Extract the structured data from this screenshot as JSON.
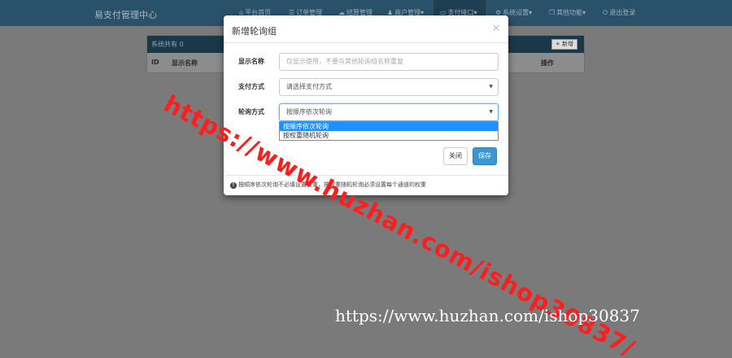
{
  "navbar": {
    "brand": "易支付管理中心",
    "items": [
      {
        "icon": "home-icon",
        "glyph": "⌂",
        "label": "平台首页"
      },
      {
        "icon": "list-icon",
        "glyph": "☰",
        "label": "订单管理"
      },
      {
        "icon": "cloud-icon",
        "glyph": "☁",
        "label": "结算管理"
      },
      {
        "icon": "user-icon",
        "glyph": "♟",
        "label": "商户管理"
      },
      {
        "icon": "card-icon",
        "glyph": "▭",
        "label": "支付接口"
      },
      {
        "icon": "gear-icon",
        "glyph": "⚙",
        "label": "系统设置"
      },
      {
        "icon": "box-icon",
        "glyph": "❒",
        "label": "其他功能"
      },
      {
        "icon": "power-icon",
        "glyph": "⏻",
        "label": "退出登录"
      }
    ]
  },
  "background_page": {
    "count_text": "系统共有 0",
    "add_label": "+ 新增",
    "columns": {
      "id": "ID",
      "name": "显示名称",
      "action": "操作"
    }
  },
  "modal": {
    "title": "新增轮询组",
    "close_glyph": "×",
    "fields": {
      "name_label": "显示名称",
      "name_placeholder": "仅显示使用，不要与其他轮询组名称重复",
      "paytype_label": "支付方式",
      "paytype_value": "请选择支付方式",
      "mode_label": "轮询方式",
      "mode_value": "按顺序依次轮询"
    },
    "mode_options": [
      "按顺序依次轮询",
      "按权重随机轮询"
    ],
    "buttons": {
      "close": "关闭",
      "save": "保存"
    },
    "note": "按顺序依次轮询不必填设置权重，按权重随机轮询必须设置每个通道的权重"
  },
  "watermarks": {
    "diagonal": "https://www.huzhan.com/ishop30837/",
    "bottom": "https://www.huzhan.com/ishop30837"
  }
}
